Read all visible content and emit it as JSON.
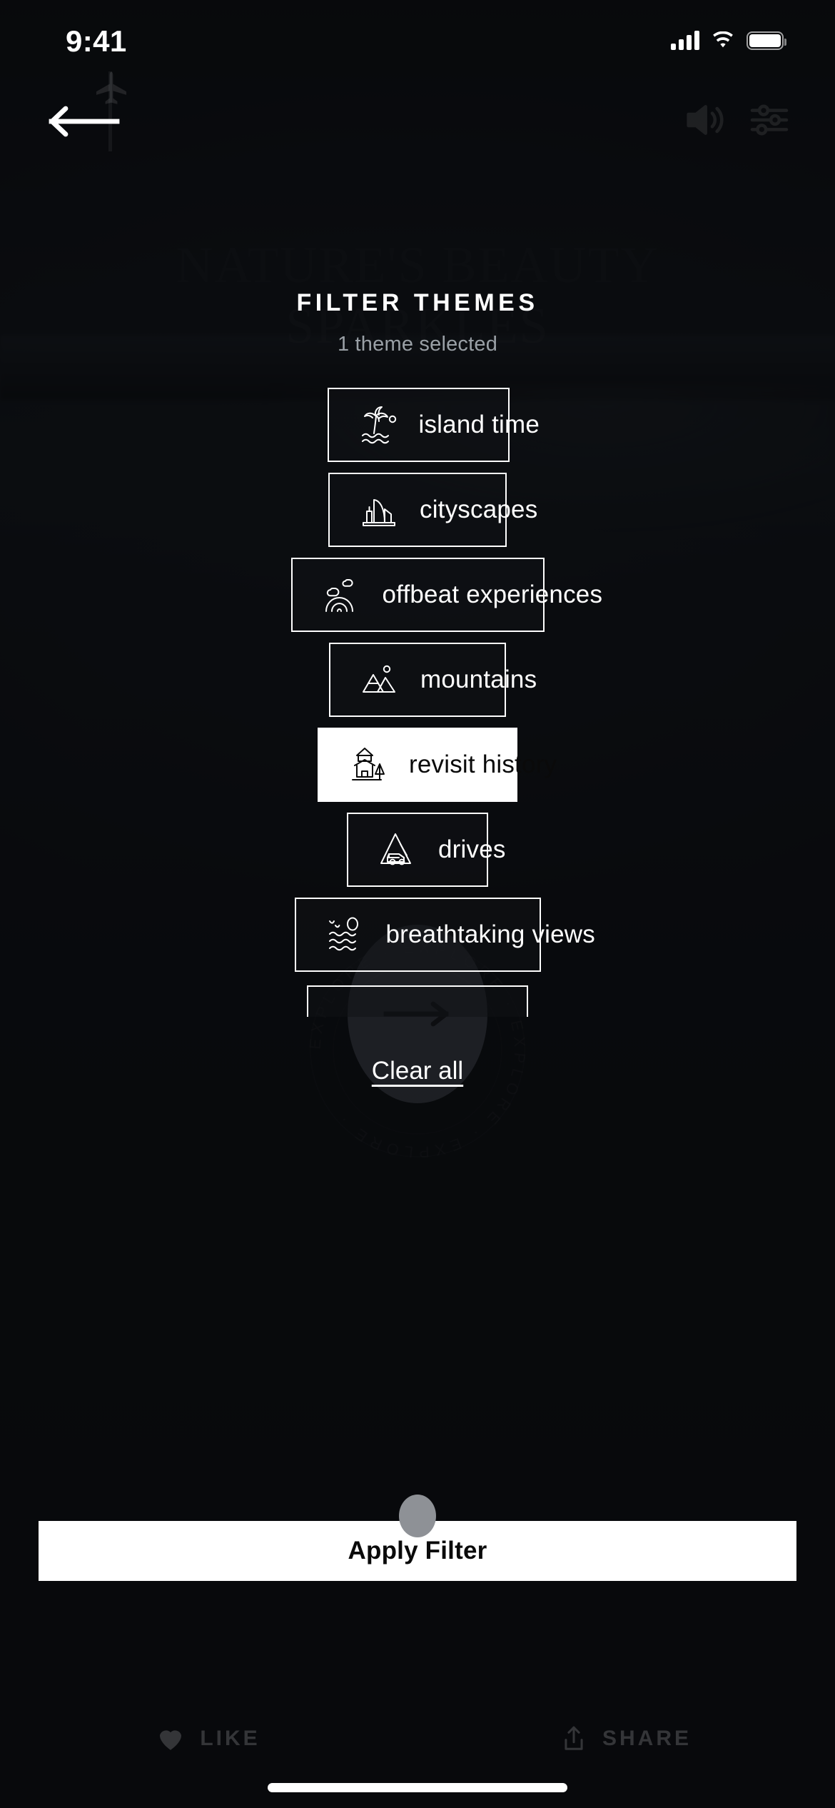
{
  "status_bar": {
    "time": "9:41",
    "cellular_icon": "signal-bars-icon",
    "wifi_icon": "wifi-icon",
    "battery_icon": "battery-full-icon"
  },
  "background": {
    "title_line1": "NATURE'S BEAUTY",
    "title_line2": "SPARKLES",
    "watermark_text": "EXPLORE · EXPLORE · EXPLORE · EXPLORE · ",
    "back_icon": "back-arrow-icon",
    "volume_icon": "volume-icon",
    "sliders_icon": "sliders-icon",
    "next_icon": "arrow-right-icon"
  },
  "sheet": {
    "title": "FILTER THEMES",
    "subtitle": "1 theme selected",
    "clear_all_label": "Clear all",
    "apply_label": "Apply Filter",
    "selected_count": 1,
    "accent_selected_bg": "#ffffff",
    "accent_selected_text": "#0a0a0a",
    "chips": [
      {
        "label": "island time",
        "icon": "palm-tree-icon",
        "selected": false
      },
      {
        "label": "cityscapes",
        "icon": "city-buildings-icon",
        "selected": false
      },
      {
        "label": "offbeat experiences",
        "icon": "rainbow-cloud-icon",
        "selected": false
      },
      {
        "label": "mountains",
        "icon": "mountains-icon",
        "selected": false
      },
      {
        "label": "revisit history",
        "icon": "temple-icon",
        "selected": true
      },
      {
        "label": "drives",
        "icon": "car-mountain-icon",
        "selected": false
      },
      {
        "label": "breathtaking views",
        "icon": "sunrise-waves-icon",
        "selected": false
      },
      {
        "label": "",
        "icon": "",
        "selected": false
      }
    ]
  },
  "bottom_actions": [
    {
      "label": "LIKE",
      "icon": "heart-icon"
    },
    {
      "label": "SHARE",
      "icon": "share-icon"
    }
  ]
}
